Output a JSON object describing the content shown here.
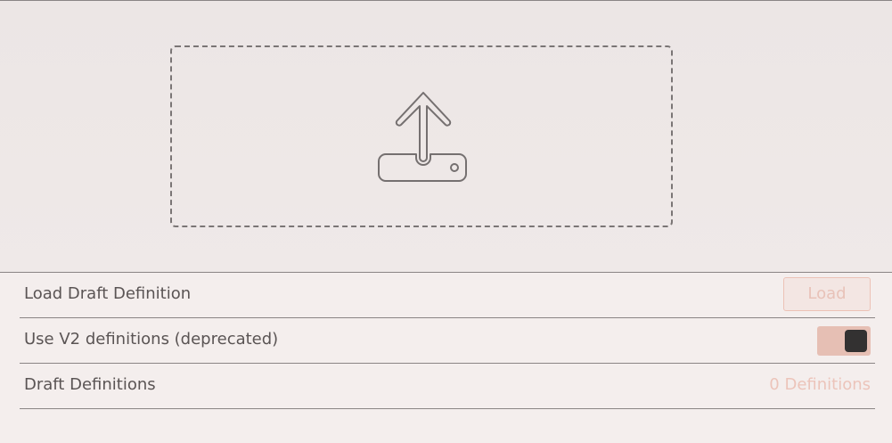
{
  "upload": {
    "icon": "upload-icon"
  },
  "settings": {
    "load_draft": {
      "label": "Load Draft Definition",
      "button_label": "Load"
    },
    "use_v2": {
      "label": "Use V2 definitions (deprecated)",
      "enabled": true
    },
    "draft_definitions": {
      "label": "Draft Definitions",
      "count_text": "0 Definitions"
    }
  },
  "colors": {
    "accent": "#e6bfb4",
    "accent_text": "#ecc4ba",
    "divider": "#8a8585",
    "knob": "#333131"
  }
}
